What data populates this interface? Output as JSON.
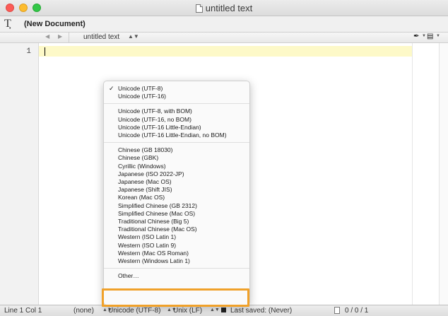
{
  "window": {
    "title": "untitled text"
  },
  "toolbar": {
    "doc_title": "(New Document)"
  },
  "navbar": {
    "file_name": "untitled text"
  },
  "editor": {
    "line_numbers": [
      "1"
    ]
  },
  "statusbar": {
    "position": "Line 1 Col 1",
    "language": "(none)",
    "encoding": "Unicode (UTF-8)",
    "line_endings": "Unix (LF)",
    "last_saved": "Last saved: (Never)",
    "counts": "0 / 0 / 1"
  },
  "encoding_menu": {
    "selected": "Unicode (UTF-8)",
    "groups": [
      [
        "Unicode (UTF-8)",
        "Unicode (UTF-16)"
      ],
      [
        "Unicode (UTF-8, with BOM)",
        "Unicode (UTF-16, no BOM)",
        "Unicode (UTF-16 Little-Endian)",
        "Unicode (UTF-16 Little-Endian, no BOM)"
      ],
      [
        "Chinese (GB 18030)",
        "Chinese (GBK)",
        "Cyrillic (Windows)",
        "Japanese (ISO 2022-JP)",
        "Japanese (Mac OS)",
        "Japanese (Shift JIS)",
        "Korean (Mac OS)",
        "Simplified Chinese (GB 2312)",
        "Simplified Chinese (Mac OS)",
        "Traditional Chinese (Big 5)",
        "Traditional Chinese (Mac OS)",
        "Western (ISO Latin 1)",
        "Western (ISO Latin 9)",
        "Western (Mac OS Roman)",
        "Western (Windows Latin 1)"
      ],
      [
        "Other…"
      ]
    ]
  },
  "colors": {
    "highlight_outline": "#f0a12a",
    "current_line": "#fdf9c8",
    "close": "#fc5b57",
    "minimize": "#fdbc2e",
    "maximize": "#33c748"
  },
  "icons": {
    "text_tool": "text-tool-icon",
    "document": "document-icon",
    "pen": "pen-icon",
    "lock": "lock-icon"
  }
}
